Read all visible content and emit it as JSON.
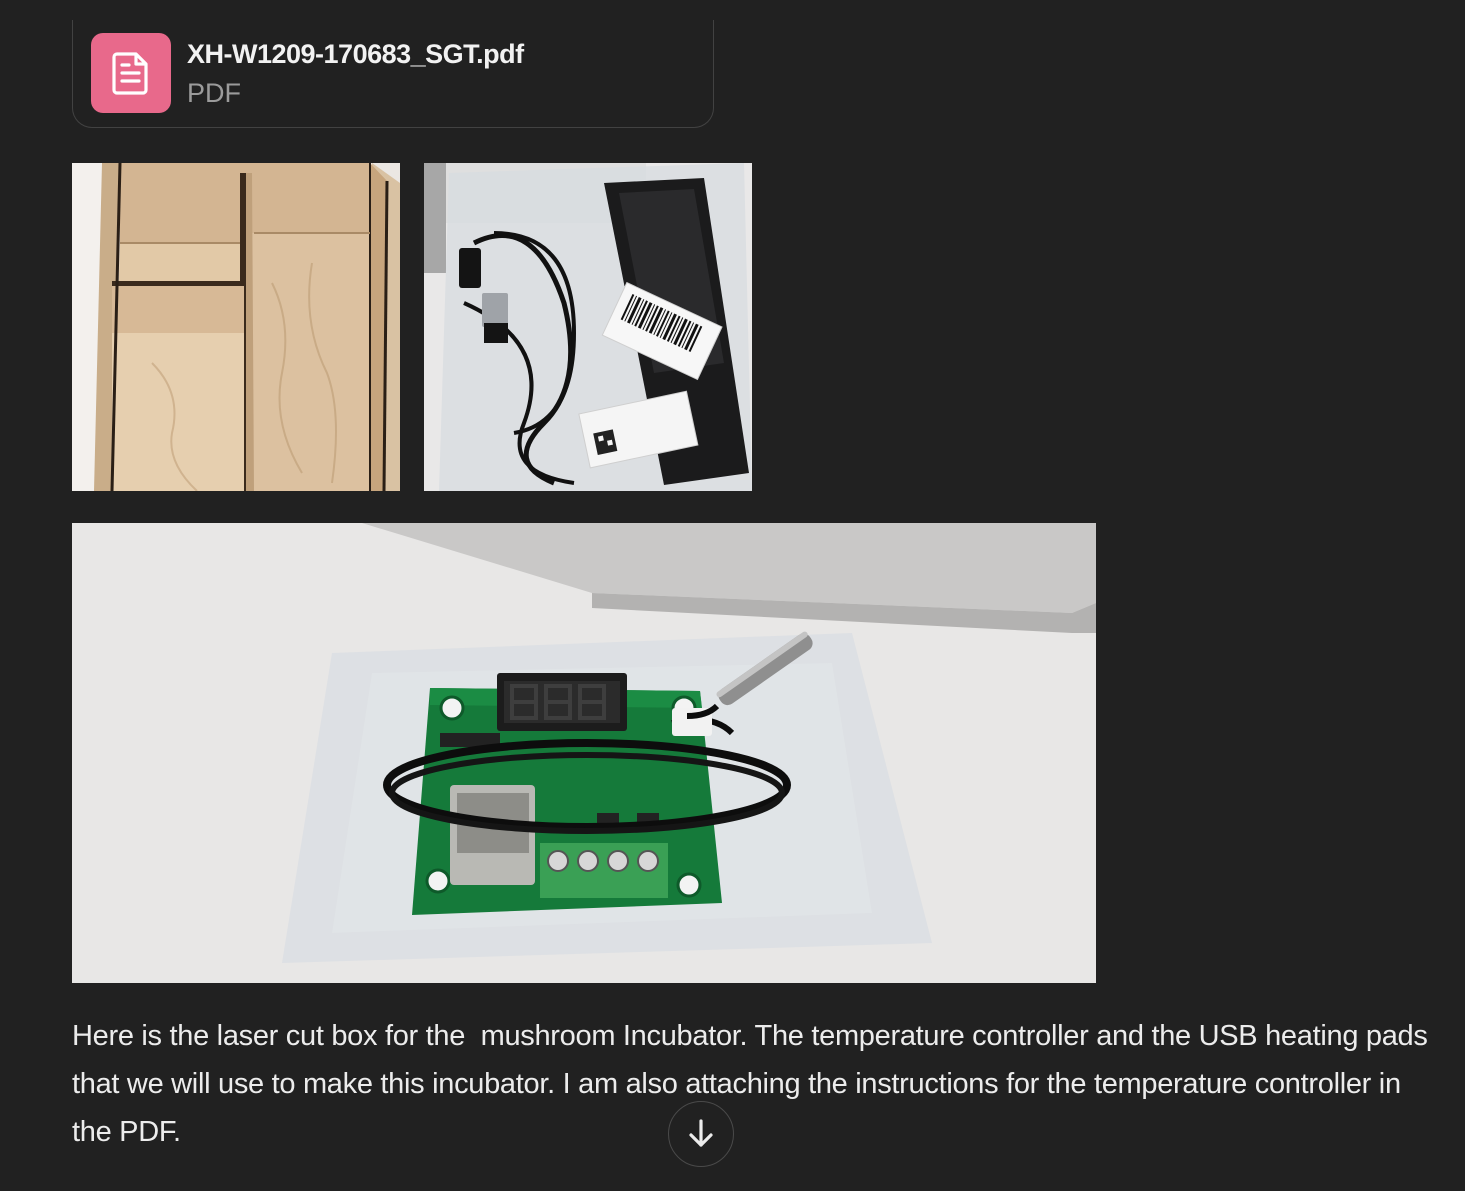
{
  "attachment": {
    "file_name": "XH-W1209-170683_SGT.pdf",
    "file_type": "PDF",
    "icon": "document-icon",
    "icon_color": "#e8698b"
  },
  "images": [
    {
      "subject": "laser cut wooden box"
    },
    {
      "subject": "USB heating pads in bag"
    },
    {
      "subject": "temperature controller board"
    }
  ],
  "message": {
    "text": "Here is the laser cut box for the  mushroom Incubator. The temperature controller and the USB heating pads that we will use to make this incubator. I am also attaching the instructions for the temperature controller in the PDF."
  },
  "scroll_button": {
    "icon": "arrow-down-icon"
  },
  "colors": {
    "background": "#212121",
    "text": "#ececec",
    "muted": "#9b9b9b"
  }
}
